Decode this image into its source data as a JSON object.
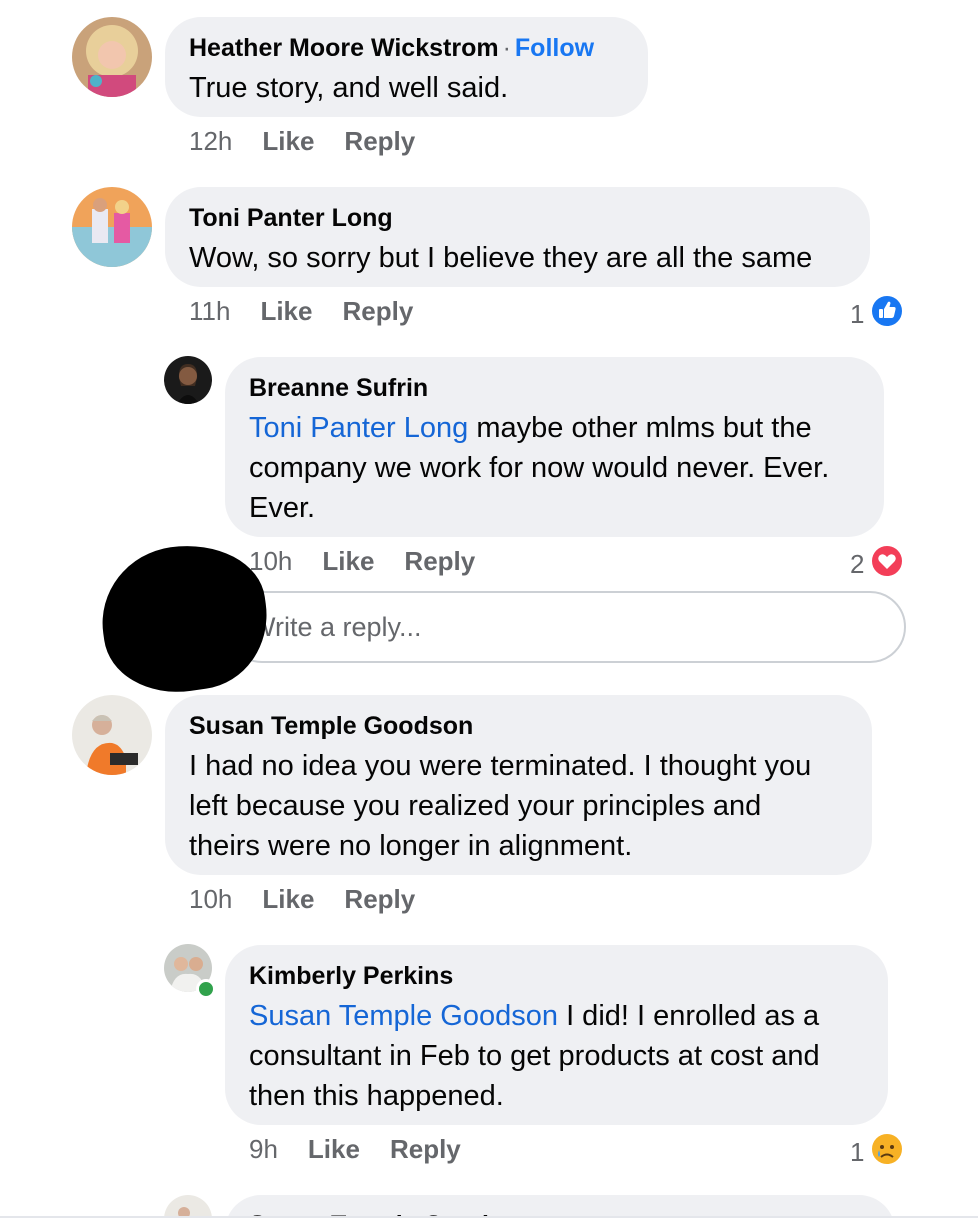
{
  "comments": [
    {
      "author": "Heather Moore Wickstrom",
      "separator": "·",
      "follow_label": "Follow",
      "text": "True story, and well said.",
      "time": "12h",
      "like_label": "Like",
      "reply_label": "Reply"
    },
    {
      "author": "Toni Panter Long",
      "text": "Wow, so sorry but I believe they are all the same",
      "time": "11h",
      "like_label": "Like",
      "reply_label": "Reply",
      "reaction_count": "1",
      "reaction_icon": "like-icon"
    },
    {
      "author": "Breanne Sufrin",
      "mention": "Toni Panter Long",
      "text_line1": " maybe other mlms but the",
      "text_line2": "company we work for now would never. Ever.",
      "text_line3": "Ever.",
      "time": "10h",
      "like_label": "Like",
      "reply_label": "Reply",
      "reaction_count": "2",
      "reaction_icon": "love-icon"
    },
    {
      "author": "Susan Temple Goodson",
      "text_line1": "I had no idea you were terminated. I thought you",
      "text_line2": "left because you realized your principles and",
      "text_line3": "theirs were no longer in alignment.",
      "time": "10h",
      "like_label": "Like",
      "reply_label": "Reply"
    },
    {
      "author": "Kimberly Perkins",
      "mention": "Susan Temple Goodson",
      "text_line1": " I did! I enrolled as a",
      "text_line2": "consultant in Feb to get products at cost and",
      "text_line3": "then this happened.",
      "time": "9h",
      "like_label": "Like",
      "reply_label": "Reply",
      "reaction_count": "1",
      "reaction_icon": "sad-icon"
    },
    {
      "author": "Susan Temple Goodson"
    }
  ],
  "reply_input": {
    "placeholder": "Write a reply..."
  },
  "colors": {
    "bubble": "#eff0f3",
    "link": "#1877f2",
    "mention": "#1566d6",
    "secondary": "#65676b",
    "like_blue": "#1877f2",
    "love_red": "#f33e58",
    "online_green": "#31a24c"
  }
}
